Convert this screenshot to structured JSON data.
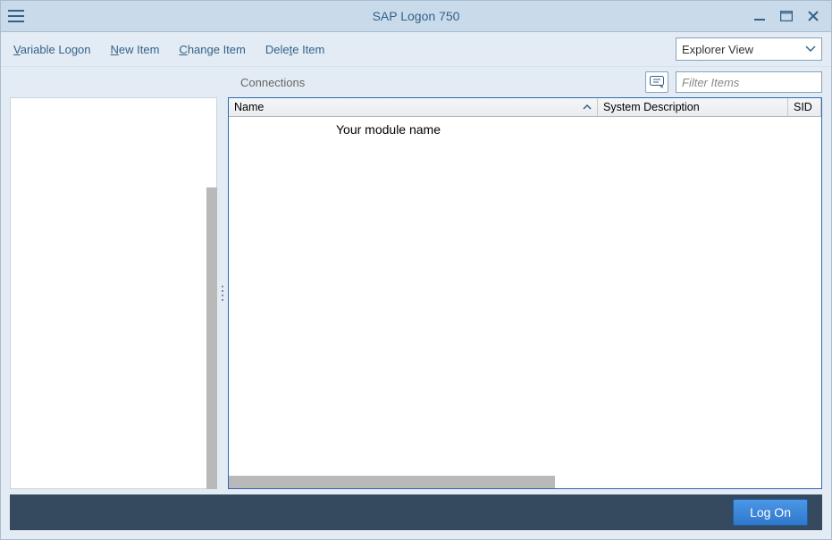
{
  "window": {
    "title": "SAP Logon 750"
  },
  "toolbar": {
    "variable_logon_pre": "V",
    "variable_logon_rest": "ariable Logon",
    "new_item_pre": "N",
    "new_item_rest": "ew Item",
    "change_item_pre": "C",
    "change_item_rest": "hange Item",
    "delete_item_pre": "Dele",
    "delete_item_u": "t",
    "delete_item_post": "e Item",
    "view_label": "Explorer View"
  },
  "section": {
    "title": "Connections",
    "filter_placeholder": "Filter Items"
  },
  "grid": {
    "columns": {
      "name": "Name",
      "system_description": "System Description",
      "sid": "SID"
    },
    "rows": [
      {
        "name": "Your module name",
        "system_description": "",
        "sid": ""
      }
    ],
    "hscroll_thumb_frac": 0.55
  },
  "footer": {
    "logon": "Log On"
  }
}
